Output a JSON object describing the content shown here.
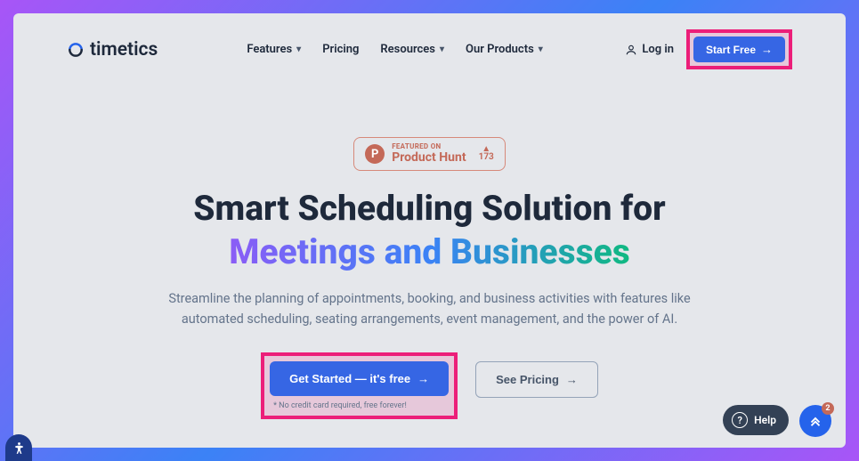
{
  "brand": {
    "name": "timetics"
  },
  "nav": {
    "features": "Features",
    "pricing": "Pricing",
    "resources": "Resources",
    "products": "Our Products"
  },
  "header_actions": {
    "login": "Log in",
    "start_free": "Start Free"
  },
  "product_hunt": {
    "featured": "FEATURED ON",
    "name": "Product Hunt",
    "votes": "173"
  },
  "hero": {
    "title_line1": "Smart Scheduling Solution for",
    "title_line2_a": "Meetings",
    "title_line2_and": " and ",
    "title_line2_b": "Businesses",
    "subtitle": "Streamline the planning of appointments, booking, and business activities with features like automated scheduling, seating arrangements, event management, and the power of AI.",
    "cta_primary": "Get Started — it's free",
    "cta_secondary": "See Pricing",
    "disclaimer": "* No credit card required, free forever!"
  },
  "floating": {
    "help": "Help",
    "notif_count": "2"
  }
}
